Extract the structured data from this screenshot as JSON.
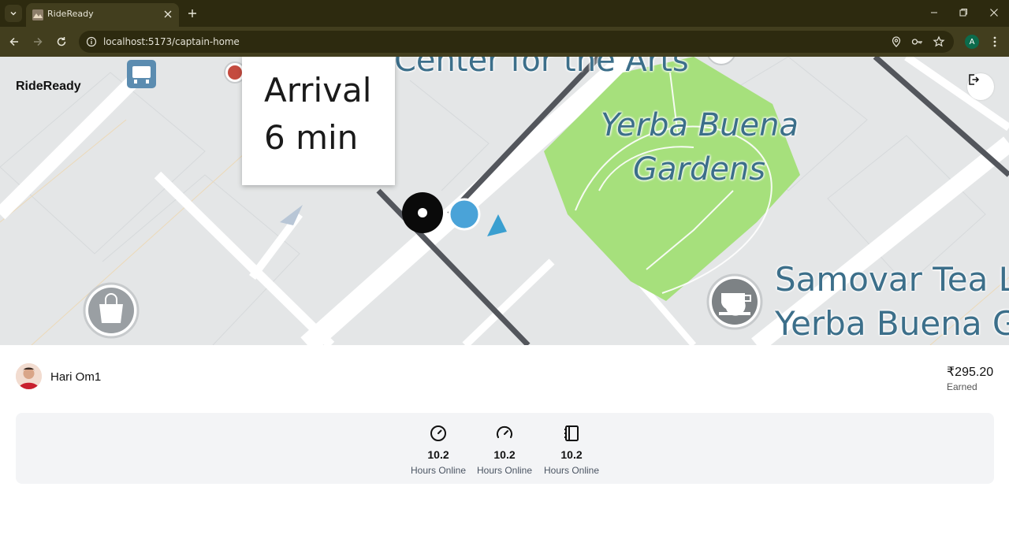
{
  "browser": {
    "tab_title": "RideReady",
    "url": "localhost:5173/captain-home",
    "profile_initial": "A"
  },
  "app": {
    "brand": "RideReady"
  },
  "map": {
    "arrival_line1": "Arrival",
    "arrival_line2": "6 min",
    "labels": {
      "center_for_arts": "Center for the Arts",
      "yerba_buena_1": "Yerba Buena",
      "yerba_buena_2": "Gardens",
      "samovar_1": "Samovar Tea L",
      "samovar_2": "Yerba Buena G"
    }
  },
  "captain": {
    "name": "Hari Om1",
    "earned_amount": "₹295.20",
    "earned_label": "Earned"
  },
  "stats": [
    {
      "icon": "timer-icon",
      "value": "10.2",
      "label": "Hours Online"
    },
    {
      "icon": "speedometer-icon",
      "value": "10.2",
      "label": "Hours Online"
    },
    {
      "icon": "notebook-icon",
      "value": "10.2",
      "label": "Hours Online"
    }
  ],
  "colors": {
    "chrome_dark": "#2d2a0f",
    "chrome_toolbar": "#423e1e",
    "park_green": "#a6e07c",
    "map_label_blue": "#3c6f8a",
    "stats_bg": "#f3f4f6"
  }
}
